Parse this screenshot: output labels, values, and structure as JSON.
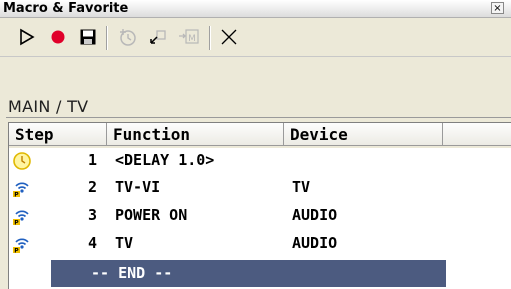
{
  "window": {
    "title": "Macro & Favorite",
    "close_glyph": "×"
  },
  "toolbar": {
    "buttons": [
      {
        "name": "play-icon"
      },
      {
        "name": "record-icon"
      },
      {
        "name": "save-icon"
      },
      {
        "name": "add-timer-icon"
      },
      {
        "name": "insert-icon"
      },
      {
        "name": "insert-macro-icon",
        "label": "M"
      },
      {
        "name": "delete-icon"
      }
    ]
  },
  "path": "MAIN / TV",
  "table": {
    "columns": [
      "Step",
      "Function",
      "Device",
      ""
    ],
    "rows": [
      {
        "icon": "clock-icon",
        "step": "1",
        "function": "<DELAY 1.0>",
        "device": ""
      },
      {
        "icon": "remote-signal-icon",
        "step": "2",
        "function": "TV-VI",
        "device": "TV"
      },
      {
        "icon": "remote-signal-icon",
        "step": "3",
        "function": "POWER ON",
        "device": "AUDIO"
      },
      {
        "icon": "remote-signal-icon",
        "step": "4",
        "function": "TV",
        "device": "AUDIO"
      }
    ],
    "end_label": "-- END --"
  },
  "colors": {
    "background": "#ece9d8",
    "end_row": "#4c5b80",
    "record": "#e0002a"
  }
}
